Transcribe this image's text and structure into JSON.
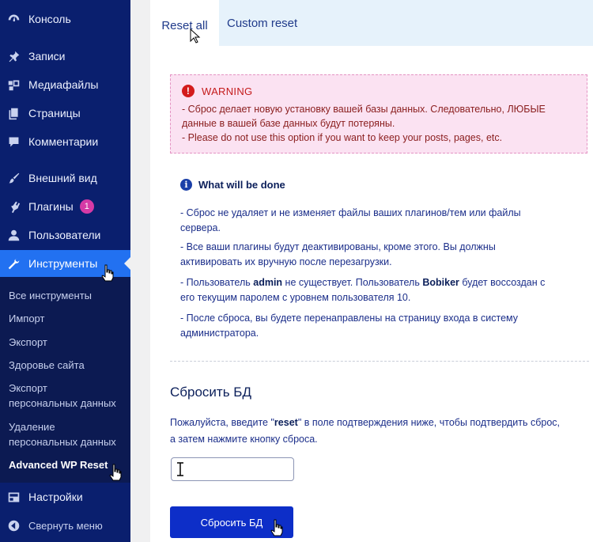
{
  "sidebar": {
    "items": [
      {
        "label": "Консоль",
        "icon": "dashboard-icon"
      },
      {
        "label": "Записи",
        "icon": "pin-icon"
      },
      {
        "label": "Медиафайлы",
        "icon": "media-icon"
      },
      {
        "label": "Страницы",
        "icon": "pages-icon"
      },
      {
        "label": "Комментарии",
        "icon": "comment-icon"
      },
      {
        "label": "Внешний вид",
        "icon": "brush-icon"
      },
      {
        "label": "Плагины",
        "icon": "plugin-icon",
        "badge": "1"
      },
      {
        "label": "Пользователи",
        "icon": "user-icon"
      },
      {
        "label": "Инструменты",
        "icon": "wrench-icon",
        "active": true
      },
      {
        "label": "Настройки",
        "icon": "settings-icon"
      },
      {
        "label": "Свернуть меню",
        "icon": "collapse-icon"
      }
    ],
    "submenu": [
      "Все инструменты",
      "Импорт",
      "Экспорт",
      "Здоровье сайта",
      "Экспорт",
      "персональных данных",
      "Удаление",
      "персональных данных",
      "Advanced WP Reset"
    ]
  },
  "tabs": {
    "reset_all": "Reset all",
    "custom_reset": "Custom reset"
  },
  "warning": {
    "title": "WARNING",
    "lines": [
      "- Сброс делает новую установку вашей базы данных. Следовательно, ЛЮБЫЕ",
      "данные в вашей базе данных будут потеряны.",
      "- Please do not use this option if you want to keep your posts, pages, etc."
    ]
  },
  "info": {
    "title": "What will be done",
    "lines": [
      "- Сброс не удаляет и не изменяет файлы ваших плагинов/тем или файлы",
      "сервера.",
      "- Все ваши плагины будут деактивированы, кроме этого. Вы должны",
      "активировать их вручную после перезагрузки.",
      "- Пользователь",
      "admin",
      "не существует. Пользователь",
      "Bobiker",
      "будет воссоздан с",
      "его текущим паролем с уровнем пользователя 10.",
      "- После сброса, вы будете перенаправлены на страницу входа в систему",
      "администратора."
    ]
  },
  "reset": {
    "title": "Сбросить БД",
    "desc_before": "Пожалуйста, введите \"",
    "desc_keyword": "reset",
    "desc_after": "\" в поле подтверждения ниже, чтобы подтвердить сброс,",
    "desc_line2": "а затем нажмите кнопку сброса.",
    "input_value": "",
    "button_label": "Сбросить БД"
  },
  "colors": {
    "sidebar_bg": "#0a1f6e",
    "active_item": "#2271f1",
    "warning_bg": "#fbe2f2",
    "button_bg": "#0d2ec8"
  }
}
